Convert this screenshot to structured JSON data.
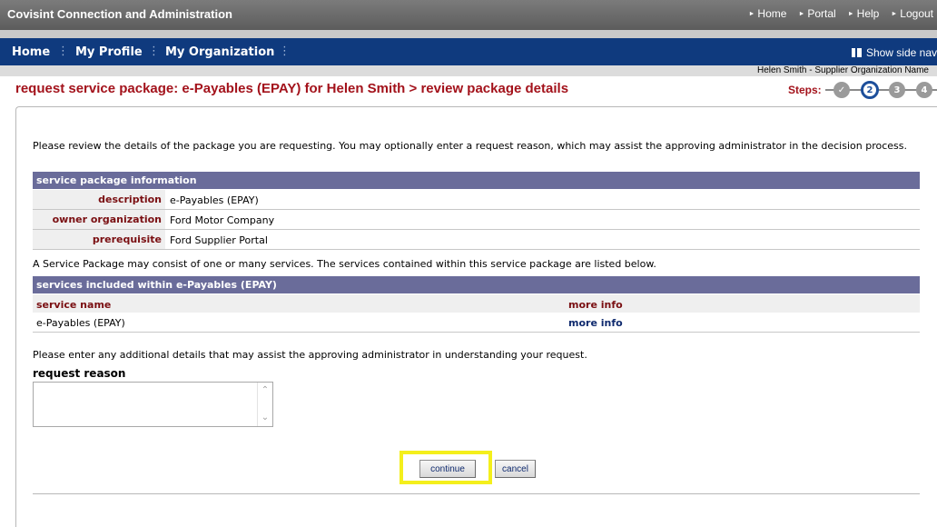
{
  "app": {
    "title": "Covisint Connection and Administration"
  },
  "top_links": [
    "Home",
    "Portal",
    "Help",
    "Logout"
  ],
  "nav": {
    "items": [
      "Home",
      "My Profile",
      "My Organization"
    ],
    "side_nav_label": "Show side nav"
  },
  "user_info": "Helen Smith - Supplier Organization Name",
  "page_heading": "request service package: e-Payables (EPAY) for Helen Smith > review package details",
  "steps": {
    "label": "Steps:",
    "items": [
      {
        "label": "✓",
        "state": "done"
      },
      {
        "label": "2",
        "state": "current"
      },
      {
        "label": "3",
        "state": "pending"
      },
      {
        "label": "4",
        "state": "pending"
      }
    ]
  },
  "intro_text": "Please review the details of the package you are requesting. You may optionally enter a request reason, which may assist the approving administrator in the decision process.",
  "package_info": {
    "header": "service package information",
    "rows": [
      {
        "label": "description",
        "value": "e-Payables (EPAY)"
      },
      {
        "label": "owner organization",
        "value": "Ford Motor Company"
      },
      {
        "label": "prerequisite",
        "value": "Ford Supplier Portal"
      }
    ]
  },
  "services_note": "A Service Package may consist of one or many services. The services contained within this service package are listed below.",
  "services": {
    "header": "services included within e-Payables (EPAY)",
    "columns": [
      "service name",
      "more info"
    ],
    "rows": [
      {
        "name": "e-Payables (EPAY)",
        "more_info": "more info"
      }
    ]
  },
  "reason": {
    "prompt": "Please enter any additional details that may assist the approving administrator in understanding your request.",
    "label": "request reason",
    "value": ""
  },
  "buttons": {
    "continue": "continue",
    "cancel": "cancel"
  },
  "colors": {
    "nav_bg": "#0f3a7e",
    "heading": "#a3121b",
    "section_bar": "#6a6c9a",
    "highlight": "#f4ef1c"
  }
}
